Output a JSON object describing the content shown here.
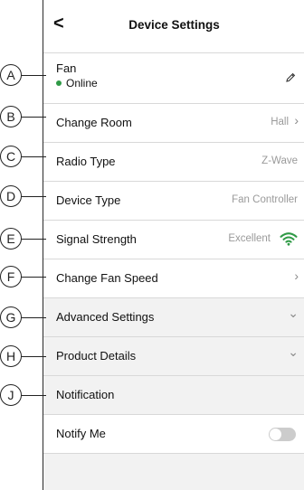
{
  "header": {
    "title": "Device Settings",
    "back_glyph": "<"
  },
  "device": {
    "name": "Fan",
    "status": "Online",
    "status_color": "#2f9a46"
  },
  "rows": [
    {
      "label": "Change Room",
      "value": "Hall",
      "chevron": "›"
    },
    {
      "label": "Radio Type",
      "value": "Z-Wave"
    },
    {
      "label": "Device Type",
      "value": "Fan Controller"
    },
    {
      "label": "Signal Strength",
      "value": "Excellent",
      "icon": "wifi-icon",
      "icon_color": "#2f9a46"
    },
    {
      "label": "Change Fan Speed",
      "chevron": "›"
    },
    {
      "label": "Advanced Settings",
      "chevron": "⌄"
    },
    {
      "label": "Product Details",
      "chevron": "⌄"
    },
    {
      "label": "Notification"
    },
    {
      "label": "Notify Me",
      "toggle_on": false
    }
  ],
  "callouts": [
    "A",
    "B",
    "C",
    "D",
    "E",
    "F",
    "G",
    "H",
    "J"
  ]
}
